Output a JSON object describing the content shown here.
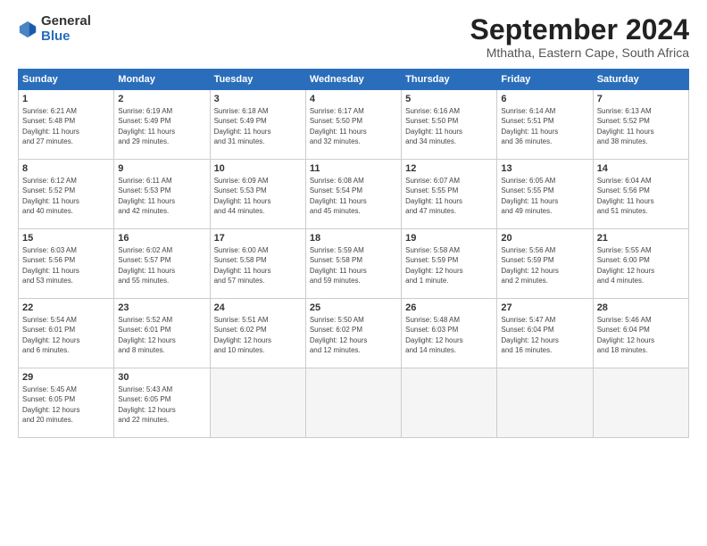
{
  "logo": {
    "general": "General",
    "blue": "Blue"
  },
  "title": "September 2024",
  "location": "Mthatha, Eastern Cape, South Africa",
  "days_of_week": [
    "Sunday",
    "Monday",
    "Tuesday",
    "Wednesday",
    "Thursday",
    "Friday",
    "Saturday"
  ],
  "weeks": [
    [
      {
        "day": "1",
        "info": "Sunrise: 6:21 AM\nSunset: 5:48 PM\nDaylight: 11 hours\nand 27 minutes."
      },
      {
        "day": "2",
        "info": "Sunrise: 6:19 AM\nSunset: 5:49 PM\nDaylight: 11 hours\nand 29 minutes."
      },
      {
        "day": "3",
        "info": "Sunrise: 6:18 AM\nSunset: 5:49 PM\nDaylight: 11 hours\nand 31 minutes."
      },
      {
        "day": "4",
        "info": "Sunrise: 6:17 AM\nSunset: 5:50 PM\nDaylight: 11 hours\nand 32 minutes."
      },
      {
        "day": "5",
        "info": "Sunrise: 6:16 AM\nSunset: 5:50 PM\nDaylight: 11 hours\nand 34 minutes."
      },
      {
        "day": "6",
        "info": "Sunrise: 6:14 AM\nSunset: 5:51 PM\nDaylight: 11 hours\nand 36 minutes."
      },
      {
        "day": "7",
        "info": "Sunrise: 6:13 AM\nSunset: 5:52 PM\nDaylight: 11 hours\nand 38 minutes."
      }
    ],
    [
      {
        "day": "8",
        "info": "Sunrise: 6:12 AM\nSunset: 5:52 PM\nDaylight: 11 hours\nand 40 minutes."
      },
      {
        "day": "9",
        "info": "Sunrise: 6:11 AM\nSunset: 5:53 PM\nDaylight: 11 hours\nand 42 minutes."
      },
      {
        "day": "10",
        "info": "Sunrise: 6:09 AM\nSunset: 5:53 PM\nDaylight: 11 hours\nand 44 minutes."
      },
      {
        "day": "11",
        "info": "Sunrise: 6:08 AM\nSunset: 5:54 PM\nDaylight: 11 hours\nand 45 minutes."
      },
      {
        "day": "12",
        "info": "Sunrise: 6:07 AM\nSunset: 5:55 PM\nDaylight: 11 hours\nand 47 minutes."
      },
      {
        "day": "13",
        "info": "Sunrise: 6:05 AM\nSunset: 5:55 PM\nDaylight: 11 hours\nand 49 minutes."
      },
      {
        "day": "14",
        "info": "Sunrise: 6:04 AM\nSunset: 5:56 PM\nDaylight: 11 hours\nand 51 minutes."
      }
    ],
    [
      {
        "day": "15",
        "info": "Sunrise: 6:03 AM\nSunset: 5:56 PM\nDaylight: 11 hours\nand 53 minutes."
      },
      {
        "day": "16",
        "info": "Sunrise: 6:02 AM\nSunset: 5:57 PM\nDaylight: 11 hours\nand 55 minutes."
      },
      {
        "day": "17",
        "info": "Sunrise: 6:00 AM\nSunset: 5:58 PM\nDaylight: 11 hours\nand 57 minutes."
      },
      {
        "day": "18",
        "info": "Sunrise: 5:59 AM\nSunset: 5:58 PM\nDaylight: 11 hours\nand 59 minutes."
      },
      {
        "day": "19",
        "info": "Sunrise: 5:58 AM\nSunset: 5:59 PM\nDaylight: 12 hours\nand 1 minute."
      },
      {
        "day": "20",
        "info": "Sunrise: 5:56 AM\nSunset: 5:59 PM\nDaylight: 12 hours\nand 2 minutes."
      },
      {
        "day": "21",
        "info": "Sunrise: 5:55 AM\nSunset: 6:00 PM\nDaylight: 12 hours\nand 4 minutes."
      }
    ],
    [
      {
        "day": "22",
        "info": "Sunrise: 5:54 AM\nSunset: 6:01 PM\nDaylight: 12 hours\nand 6 minutes."
      },
      {
        "day": "23",
        "info": "Sunrise: 5:52 AM\nSunset: 6:01 PM\nDaylight: 12 hours\nand 8 minutes."
      },
      {
        "day": "24",
        "info": "Sunrise: 5:51 AM\nSunset: 6:02 PM\nDaylight: 12 hours\nand 10 minutes."
      },
      {
        "day": "25",
        "info": "Sunrise: 5:50 AM\nSunset: 6:02 PM\nDaylight: 12 hours\nand 12 minutes."
      },
      {
        "day": "26",
        "info": "Sunrise: 5:48 AM\nSunset: 6:03 PM\nDaylight: 12 hours\nand 14 minutes."
      },
      {
        "day": "27",
        "info": "Sunrise: 5:47 AM\nSunset: 6:04 PM\nDaylight: 12 hours\nand 16 minutes."
      },
      {
        "day": "28",
        "info": "Sunrise: 5:46 AM\nSunset: 6:04 PM\nDaylight: 12 hours\nand 18 minutes."
      }
    ],
    [
      {
        "day": "29",
        "info": "Sunrise: 5:45 AM\nSunset: 6:05 PM\nDaylight: 12 hours\nand 20 minutes."
      },
      {
        "day": "30",
        "info": "Sunrise: 5:43 AM\nSunset: 6:05 PM\nDaylight: 12 hours\nand 22 minutes."
      },
      {
        "day": "",
        "info": ""
      },
      {
        "day": "",
        "info": ""
      },
      {
        "day": "",
        "info": ""
      },
      {
        "day": "",
        "info": ""
      },
      {
        "day": "",
        "info": ""
      }
    ]
  ]
}
